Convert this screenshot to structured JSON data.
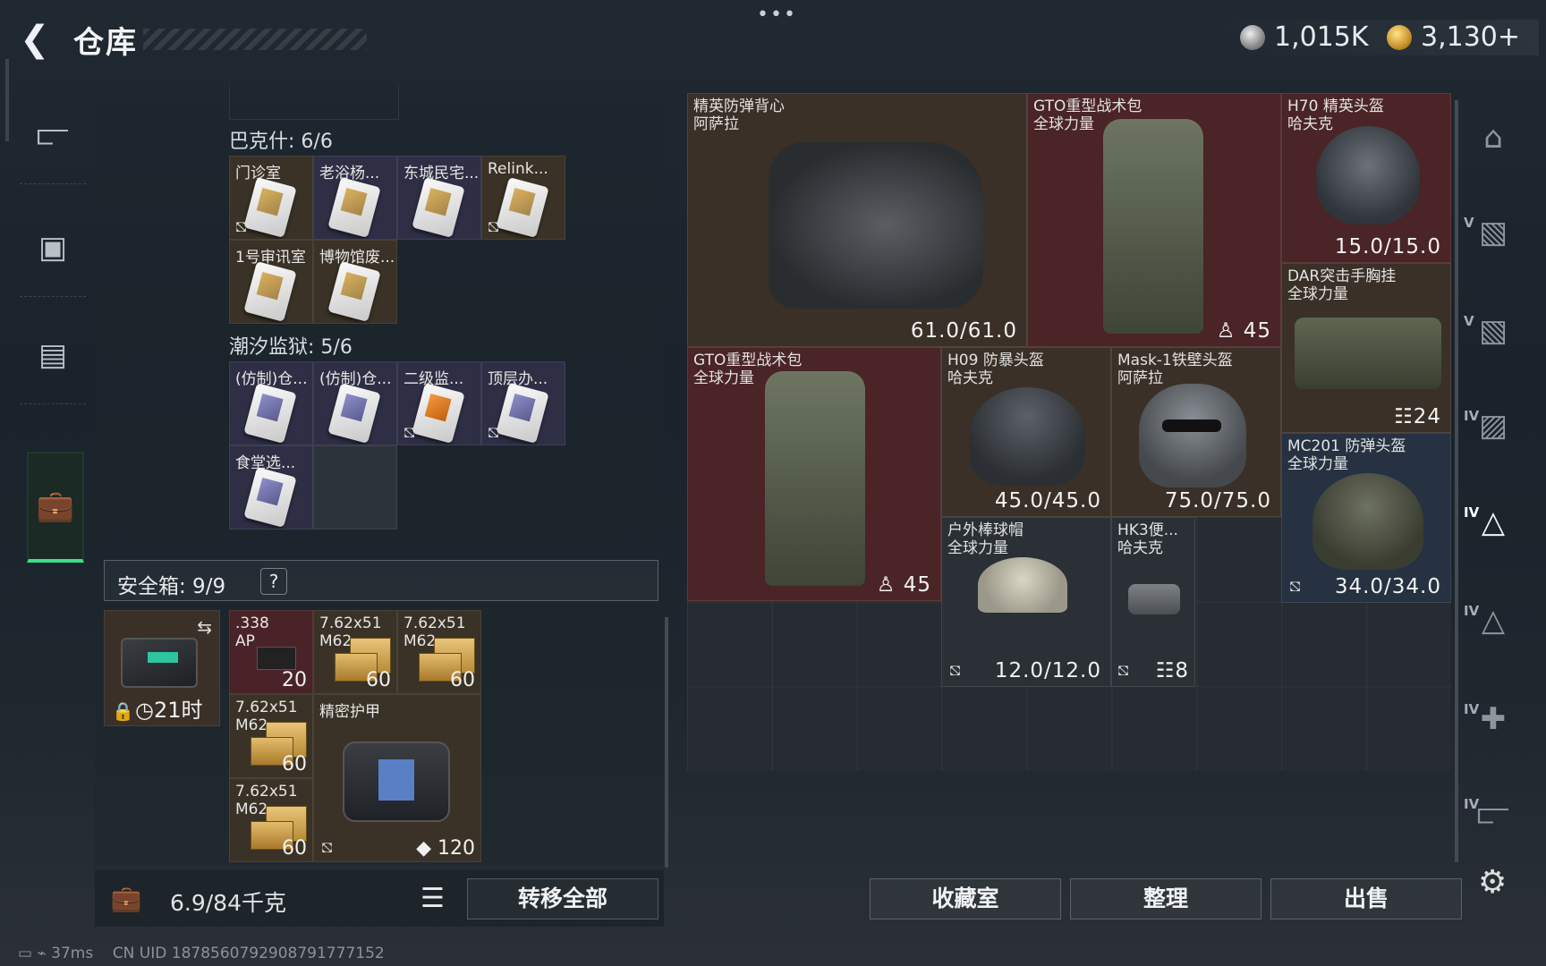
{
  "header": {
    "title": "仓库",
    "currency1": "1,015K",
    "currency2": "3,130+"
  },
  "left": {
    "bakeshi": {
      "title": "巴克什: 6/6",
      "items": [
        {
          "name": "门诊室",
          "type": "gold",
          "locked": true
        },
        {
          "name": "老浴杨...",
          "type": "purple",
          "locked": false
        },
        {
          "name": "东城民宅...",
          "type": "purple",
          "locked": false
        },
        {
          "name": "Relink...",
          "type": "gold",
          "locked": true
        },
        {
          "name": "1号审讯室",
          "type": "gold",
          "locked": false
        },
        {
          "name": "博物馆废...",
          "type": "gold",
          "locked": false
        }
      ]
    },
    "chaoxi": {
      "title": "潮汐监狱: 5/6",
      "items": [
        {
          "name": "(仿制)仓...",
          "type": "purple",
          "locked": false
        },
        {
          "name": "(仿制)仓...",
          "type": "purple",
          "locked": false
        },
        {
          "name": "二级监...",
          "type": "orange",
          "locked": true
        },
        {
          "name": "顶层办...",
          "type": "purple",
          "locked": true
        },
        {
          "name": "食堂选...",
          "type": "purple",
          "locked": false
        }
      ]
    },
    "safebox": {
      "label": "安全箱: 9/9",
      "help": "?",
      "timer": "21时",
      "items": [
        {
          "name": ".338 AP",
          "count": "20"
        },
        {
          "name": "7.62x51 M62",
          "count": "60"
        },
        {
          "name": "7.62x51 M62",
          "count": "60"
        },
        {
          "name": "7.62x51 M62",
          "count": "60"
        },
        {
          "name": "7.62x51 M62",
          "count": "60"
        },
        {
          "name": "精密护甲",
          "count": "120"
        }
      ]
    },
    "weight": "6.9/84千克",
    "transfer_all": "转移全部"
  },
  "right": {
    "items": [
      {
        "name": "精英防弹背心\n阿萨拉",
        "value": "61.0/61.0"
      },
      {
        "name": "GTO重型战术包\n全球力量",
        "value": "45"
      },
      {
        "name": "H70 精英头盔\n哈夫克",
        "value": "15.0/15.0"
      },
      {
        "name": "DAR突击手胸挂\n全球力量",
        "value": "24"
      },
      {
        "name": "GTO重型战术包\n全球力量",
        "value": "45"
      },
      {
        "name": "H09 防暴头盔\n哈夫克",
        "value": "45.0/45.0"
      },
      {
        "name": "Mask-1铁壁头盔\n阿萨拉",
        "value": "75.0/75.0"
      },
      {
        "name": "MC201 防弹头盔\n全球力量",
        "value": "34.0/34.0"
      },
      {
        "name": "户外棒球帽\n全球力量",
        "value": "12.0/12.0"
      },
      {
        "name": "HK3便...\n哈夫克",
        "value": "8"
      }
    ],
    "buttons": {
      "collection": "收藏室",
      "sort": "整理",
      "sell": "出售"
    },
    "tabs": [
      "V",
      "V",
      "IV",
      "IV",
      "IV",
      "IV",
      "IV"
    ]
  },
  "status": {
    "ping": "37ms",
    "uid": "CN UID 1878560792908791777152"
  }
}
